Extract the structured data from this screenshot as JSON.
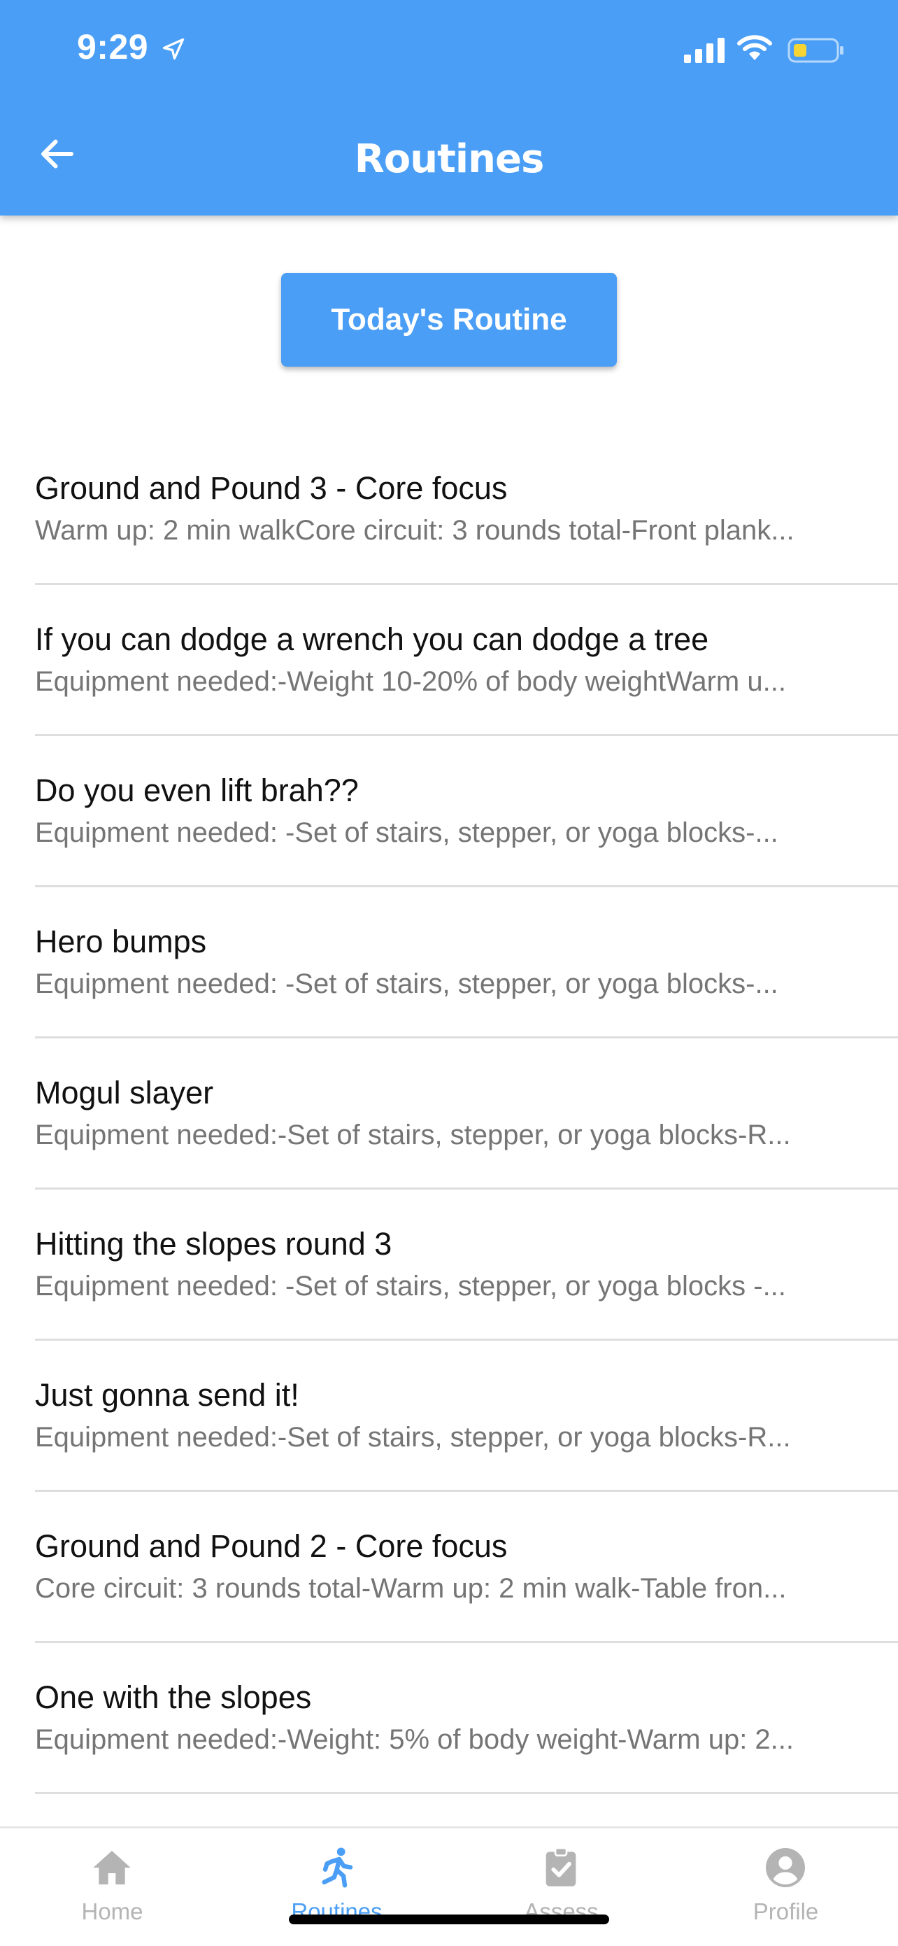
{
  "status_bar": {
    "time": "9:29"
  },
  "nav": {
    "title": "Routines",
    "back_icon": "arrow-left-icon"
  },
  "today_button": {
    "label": "Today's Routine"
  },
  "routines": [
    {
      "title": "Ground and Pound 3 - Core focus",
      "subtitle": "Warm up: 2 min walkCore circuit: 3 rounds total-Front plank..."
    },
    {
      "title": "If you can dodge a wrench you can dodge a tree",
      "subtitle": "Equipment needed:-Weight 10-20% of body weightWarm u..."
    },
    {
      "title": "Do you even lift brah??",
      "subtitle": "Equipment needed: -Set of stairs, stepper, or yoga blocks-..."
    },
    {
      "title": "Hero bumps",
      "subtitle": "Equipment needed: -Set of stairs, stepper, or yoga blocks-..."
    },
    {
      "title": "Mogul slayer",
      "subtitle": "Equipment needed:-Set of stairs, stepper, or yoga blocks-R..."
    },
    {
      "title": "Hitting the slopes round 3",
      "subtitle": "Equipment needed: -Set of stairs, stepper, or yoga blocks -..."
    },
    {
      "title": "Just gonna send it!",
      "subtitle": "Equipment needed:-Set of stairs, stepper, or yoga blocks-R..."
    },
    {
      "title": "Ground and Pound 2 - Core focus",
      "subtitle": "Core circuit: 3 rounds total-Warm up: 2 min walk-Table fron..."
    },
    {
      "title": "One with the slopes",
      "subtitle": "Equipment needed:-Weight: 5% of body weight-Warm up: 2..."
    }
  ],
  "tabs": [
    {
      "label": "Home",
      "icon": "home-icon",
      "active": false
    },
    {
      "label": "Routines",
      "icon": "running-person-icon",
      "active": true
    },
    {
      "label": "Assess",
      "icon": "clipboard-check-icon",
      "active": false
    },
    {
      "label": "Profile",
      "icon": "user-circle-icon",
      "active": false
    }
  ],
  "colors": {
    "accent": "#4a9ef5",
    "inactive_tab": "#b4b4b4",
    "subtitle": "#757575",
    "divider": "#dedede",
    "battery_fill": "#f5d433"
  }
}
